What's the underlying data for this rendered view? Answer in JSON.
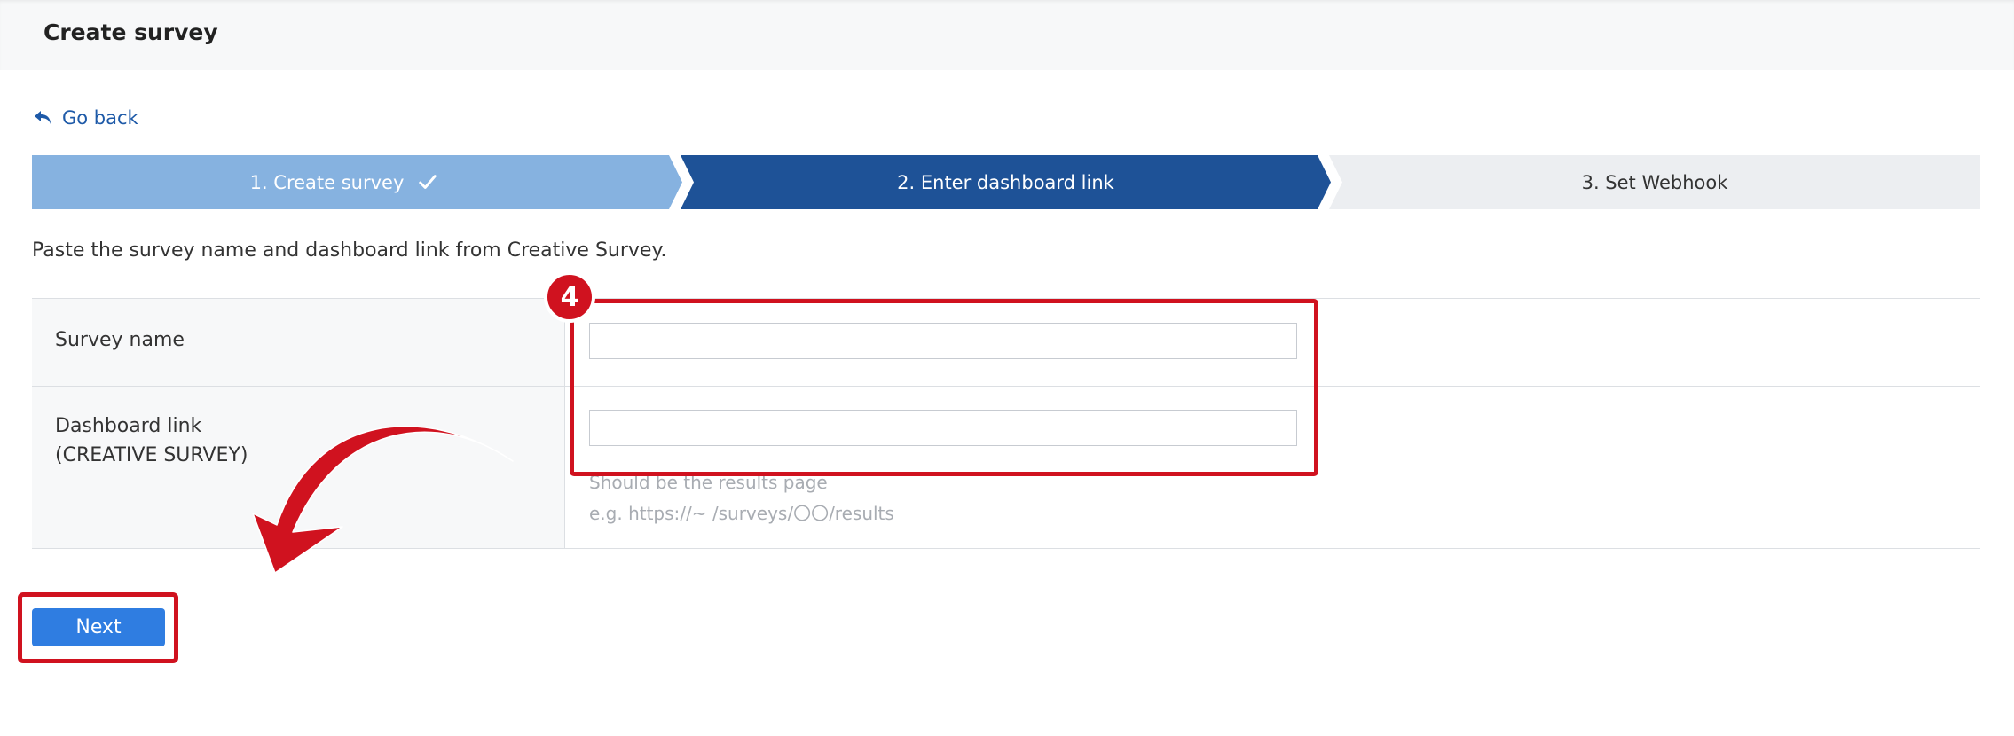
{
  "header": {
    "title": "Create survey"
  },
  "nav": {
    "go_back_label": "Go back",
    "go_back_icon": "undo-arrow-icon"
  },
  "stepper": {
    "steps": [
      {
        "label": "1. Create survey",
        "state": "completed",
        "icon": "checkmark-icon"
      },
      {
        "label": "2. Enter dashboard link",
        "state": "active"
      },
      {
        "label": "3. Set Webhook",
        "state": "pending"
      }
    ]
  },
  "instruction": "Paste the survey name and dashboard link from Creative Survey.",
  "form": {
    "survey_name": {
      "label": "Survey name",
      "value": ""
    },
    "dashboard_link": {
      "label_line1": "Dashboard link",
      "label_line2": "(CREATIVE SURVEY)",
      "value": "",
      "hint_line1": "Should be the results page",
      "hint_line2": "e.g. https://~ /surveys/〇〇/results"
    }
  },
  "actions": {
    "next_label": "Next"
  },
  "annotation": {
    "step_number": "4"
  },
  "colors": {
    "accent": "#1e5297",
    "step_completed": "#86b2e0",
    "step_pending": "#eceef1",
    "button": "#2f7de1",
    "highlight": "#d0121f"
  }
}
